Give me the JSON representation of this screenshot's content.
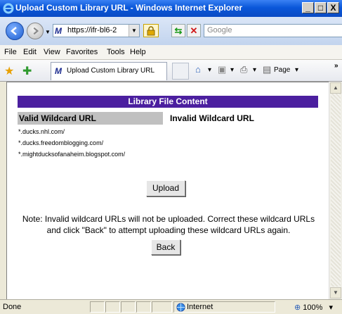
{
  "window": {
    "title": "Upload Custom Library URL - Windows Internet Explorer",
    "buttons": {
      "minimize": "_",
      "maximize": "□",
      "close": "X"
    }
  },
  "address_bar": {
    "url": "https://ifr-bl6-2",
    "search_placeholder": "Google"
  },
  "menu": {
    "items": [
      "File",
      "Edit",
      "View",
      "Favorites",
      "Tools",
      "Help"
    ]
  },
  "toolbar": {
    "tab_title": "Upload Custom Library URL",
    "page_label": "Page",
    "overflow": "»"
  },
  "content": {
    "header": "Library File Content",
    "valid_heading": "Valid Wildcard URL",
    "invalid_heading": "Invalid Wildcard URL",
    "valid_urls": [
      "*.ducks.nhl.com/",
      "*.ducks.freedomblogging.com/",
      "*.mightducksofanaheim.blogspot.com/"
    ],
    "upload_button": "Upload",
    "note": "Note: Invalid wildcard URLs will not be uploaded. Correct these wildcard URLs and click \"Back\" to attempt uploading these wildcard URLs again.",
    "back_button": "Back"
  },
  "status_bar": {
    "status": "Done",
    "zone": "Internet",
    "zoom": "100%"
  },
  "colors": {
    "header_band": "#4b1f9f",
    "valid_heading_bg": "#c0c0c0"
  }
}
